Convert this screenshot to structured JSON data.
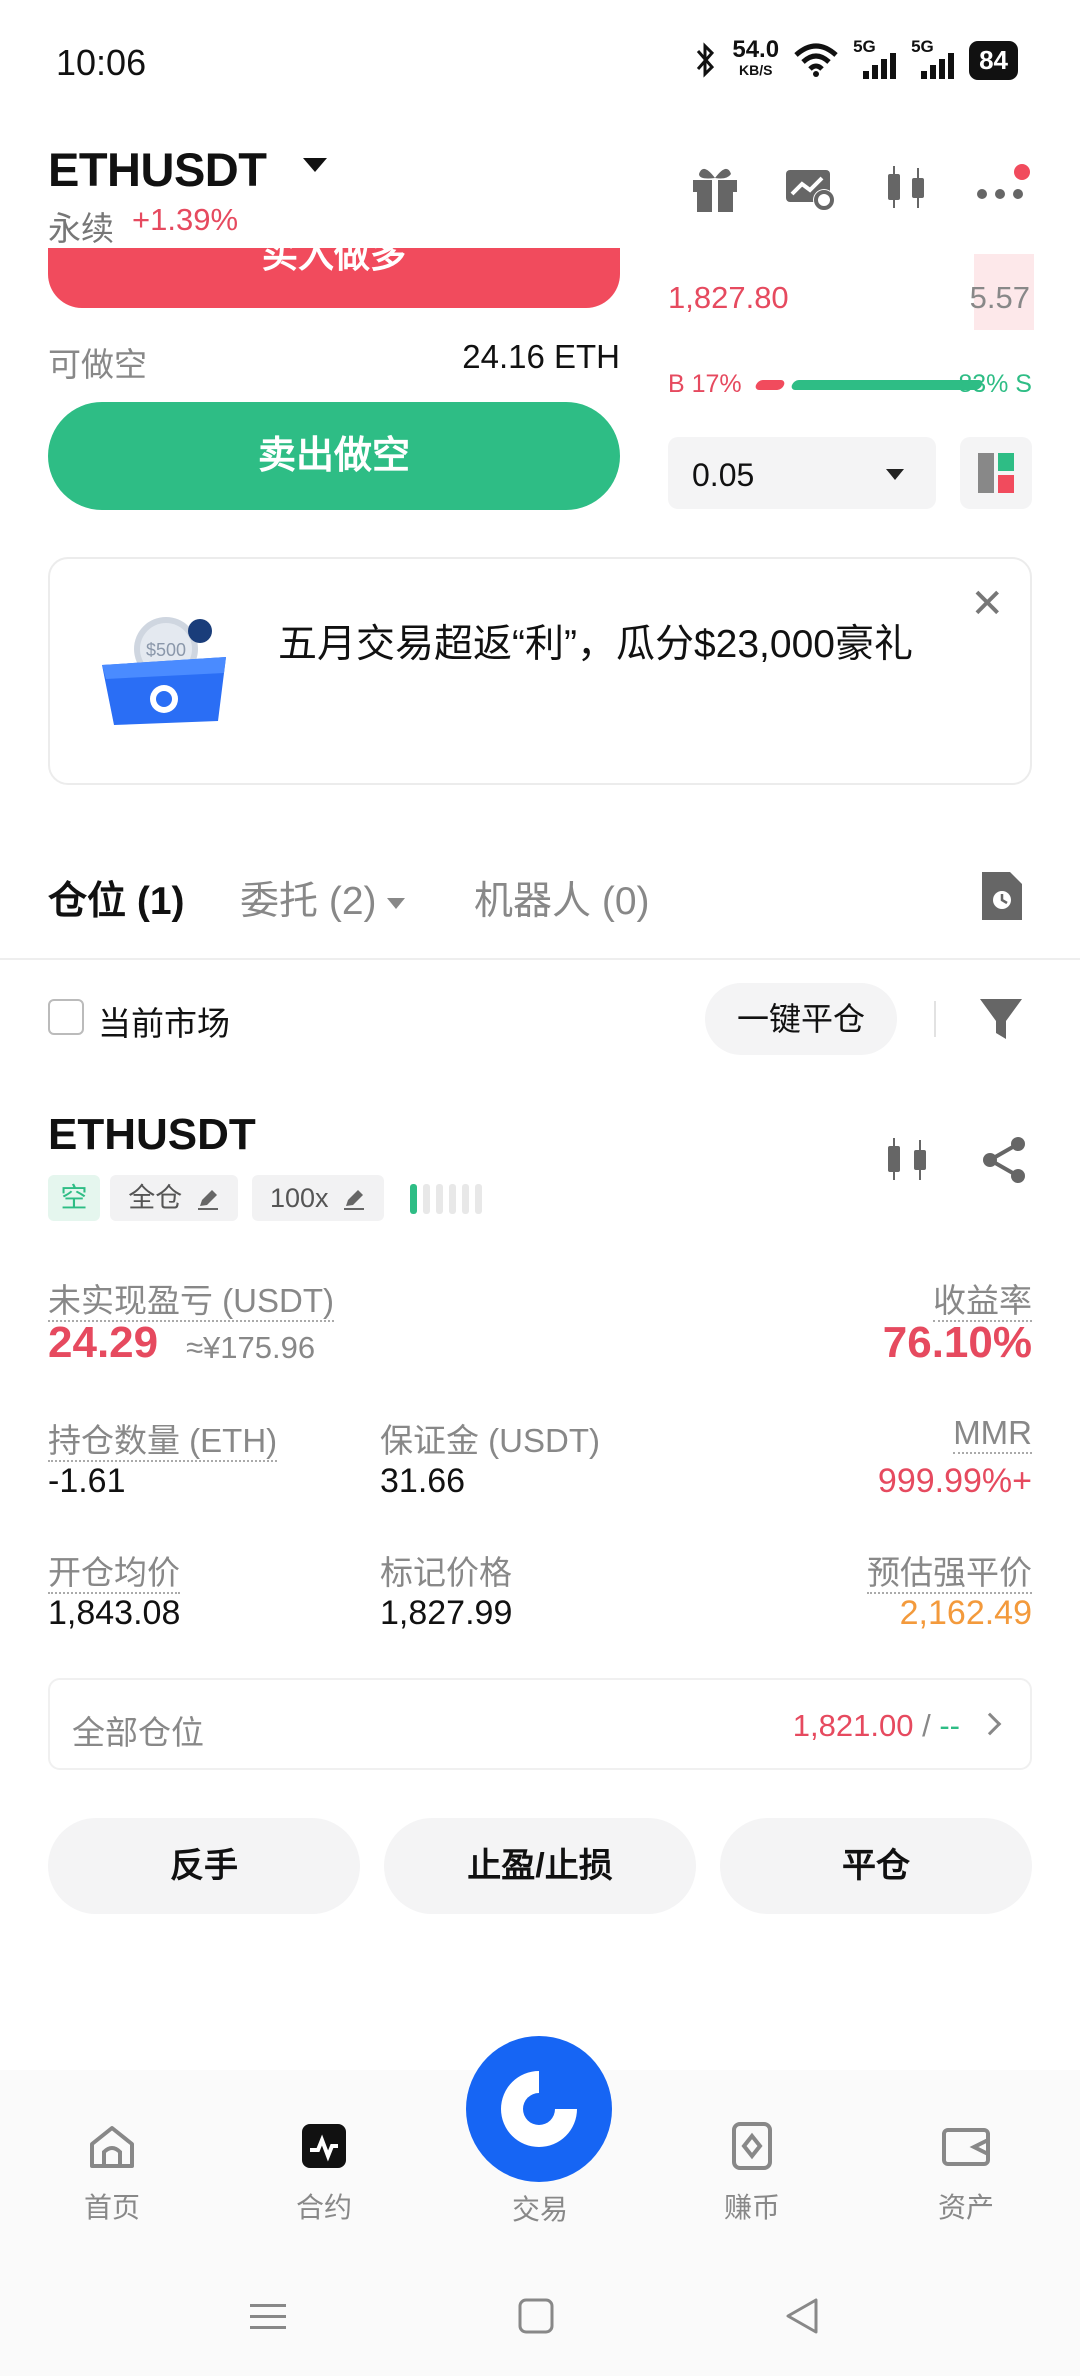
{
  "status_bar": {
    "time": "10:06",
    "net_speed": "54.0",
    "net_unit": "KB/S",
    "signal1": "5G",
    "signal2": "5G",
    "battery": "84"
  },
  "header": {
    "symbol": "ETHUSDT",
    "perp_label": "永续",
    "change": "+1.39%"
  },
  "trade_panel": {
    "buy_label": "买入做多",
    "short_avail_label": "可做空",
    "short_avail_value": "24.16 ETH",
    "sell_label": "卖出做空"
  },
  "orderbook": {
    "price": "1,827.80",
    "qty": "5.57",
    "buy_ratio": "B 17%",
    "sell_ratio": "83% S",
    "buy_ratio_value": 0.17,
    "sell_ratio_value": 0.83,
    "qty_select": "0.05"
  },
  "banner": {
    "text": "五月交易超返“利”，瓜分$23,000豪礼",
    "coin_text": "$500"
  },
  "tabs": [
    {
      "label": "仓位 (1)"
    },
    {
      "label": "委托 (2)"
    },
    {
      "label": "机器人 (0)"
    }
  ],
  "filter": {
    "current_market_label": "当前市场",
    "close_all_label": "一键平仓"
  },
  "position": {
    "symbol": "ETHUSDT",
    "side_tag": "空",
    "margin_mode": "全仓",
    "leverage": "100x",
    "unrealized_pnl_label": "未实现盈亏 (USDT)",
    "unrealized_pnl": "24.29",
    "unrealized_pnl_cny": "≈¥175.96",
    "roe_label": "收益率",
    "roe": "76.10%",
    "size_label": "持仓数量 (ETH)",
    "size": "-1.61",
    "margin_label": "保证金 (USDT)",
    "margin": "31.66",
    "mmr_label": "MMR",
    "mmr": "999.99%+",
    "entry_label": "开仓均价",
    "entry": "1,843.08",
    "mark_label": "标记价格",
    "mark": "1,827.99",
    "liq_label": "预估强平价",
    "liq": "2,162.49",
    "all_positions_label": "全部仓位",
    "all_positions_value": "1,821.00",
    "all_positions_sep": "/",
    "all_positions_value2": "--"
  },
  "actions": {
    "reverse": "反手",
    "tpsl": "止盈/止损",
    "close": "平仓"
  },
  "bottom_nav": [
    {
      "label": "首页",
      "icon": "home-icon"
    },
    {
      "label": "合约",
      "icon": "futures-icon"
    },
    {
      "label": "交易",
      "icon": "trade-logo-icon"
    },
    {
      "label": "赚币",
      "icon": "earn-icon"
    },
    {
      "label": "资产",
      "icon": "wallet-icon"
    }
  ],
  "colors": {
    "red": "#f14b5d",
    "green": "#2ebd85",
    "blue": "#1665f4",
    "orange": "#f39a3c"
  }
}
